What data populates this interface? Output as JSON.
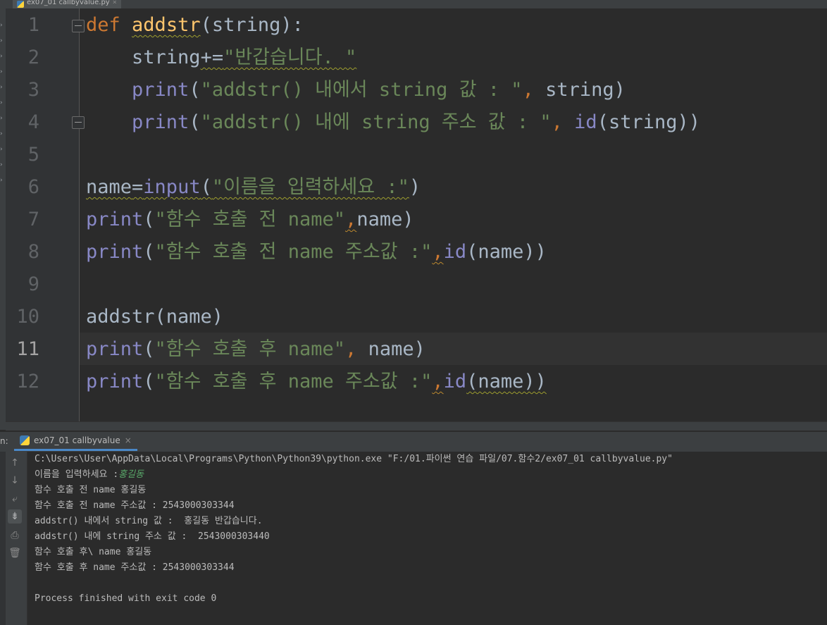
{
  "editor_tab": {
    "label": "ex07_01 callbyvalue.py"
  },
  "left_strip_marks": [
    "›",
    "›",
    "›",
    "›",
    "›",
    "›",
    "›",
    "›",
    "›",
    "›",
    "›"
  ],
  "line_numbers": [
    "1",
    "2",
    "3",
    "4",
    "5",
    "6",
    "7",
    "8",
    "9",
    "10",
    "11",
    "12"
  ],
  "current_line": "11",
  "code": {
    "l1": {
      "a": "def",
      "b": " ",
      "c": "addstr",
      "d": "(string):"
    },
    "l2": {
      "a": "    string",
      "b": "+=",
      "c": "\"반갑습니다. \""
    },
    "l3": {
      "a": "    ",
      "b": "print",
      "c": "(",
      "d": "\"addstr() 내에서 string 값 : \"",
      "e": ", ",
      "f": "string)"
    },
    "l4": {
      "a": "    ",
      "b": "print",
      "c": "(",
      "d": "\"addstr() 내에 string 주소 값 : \"",
      "e": ", ",
      "f": "id",
      "g": "(string))"
    },
    "l6": {
      "a": "name",
      "b": "=",
      "c": "input",
      "d": "(",
      "e": "\"이름을 입력하세요 :\"",
      "f": ")"
    },
    "l7": {
      "a": "print",
      "b": "(",
      "c": "\"함수 호출 전 name\"",
      "d": ",",
      "e": "name)"
    },
    "l8": {
      "a": "print",
      "b": "(",
      "c": "\"함수 호출 전 name 주소값 :\"",
      "d": ",",
      "e": "id",
      "f": "(name))"
    },
    "l10": {
      "a": "addstr(name)"
    },
    "l11": {
      "a": "print",
      "b": "(",
      "c": "\"함수 호출 후 name\"",
      "d": ", ",
      "e": "name)"
    },
    "l12": {
      "a": "print",
      "b": "(",
      "c": "\"함수 호출 후 name 주소값 :\"",
      "d": ",",
      "e": "id",
      "f": "(name))"
    }
  },
  "run_panel": {
    "label": "n:",
    "tab_label": "ex07_01 callbyvalue",
    "tab_close": "×",
    "toolbar_icons": [
      "up-arrow-icon",
      "down-arrow-icon",
      "soft-wrap-icon",
      "scroll-to-end-icon",
      "print-icon",
      "trash-icon"
    ]
  },
  "console": {
    "line1": "C:\\Users\\User\\AppData\\Local\\Programs\\Python\\Python39\\python.exe \"F:/01.파이썬 연습 파일/07.함수2/ex07_01 callbyvalue.py\"",
    "line2_prompt": "이름을 입력하세요 :",
    "line2_input": "홍길동",
    "line3": "함수 호출 전 name 홍길동",
    "line4": "함수 호출 전 name 주소값 : 2543000303344",
    "line5": "addstr() 내에서 string 값 :  홍길동 반갑습니다.",
    "line6": "addstr() 내에 string 주소 값 :  2543000303440",
    "line7": "함수 호출 후\\ name 홍길동",
    "line8": "함수 호출 후 name 주소값 : 2543000303344",
    "line10": "Process finished with exit code 0"
  },
  "colors": {
    "keyword": "#cc7832",
    "function_def": "#ffc66d",
    "string": "#6a8759",
    "builtin": "#8888c6",
    "plain": "#a9b7c6",
    "user_input": "#59a869"
  }
}
